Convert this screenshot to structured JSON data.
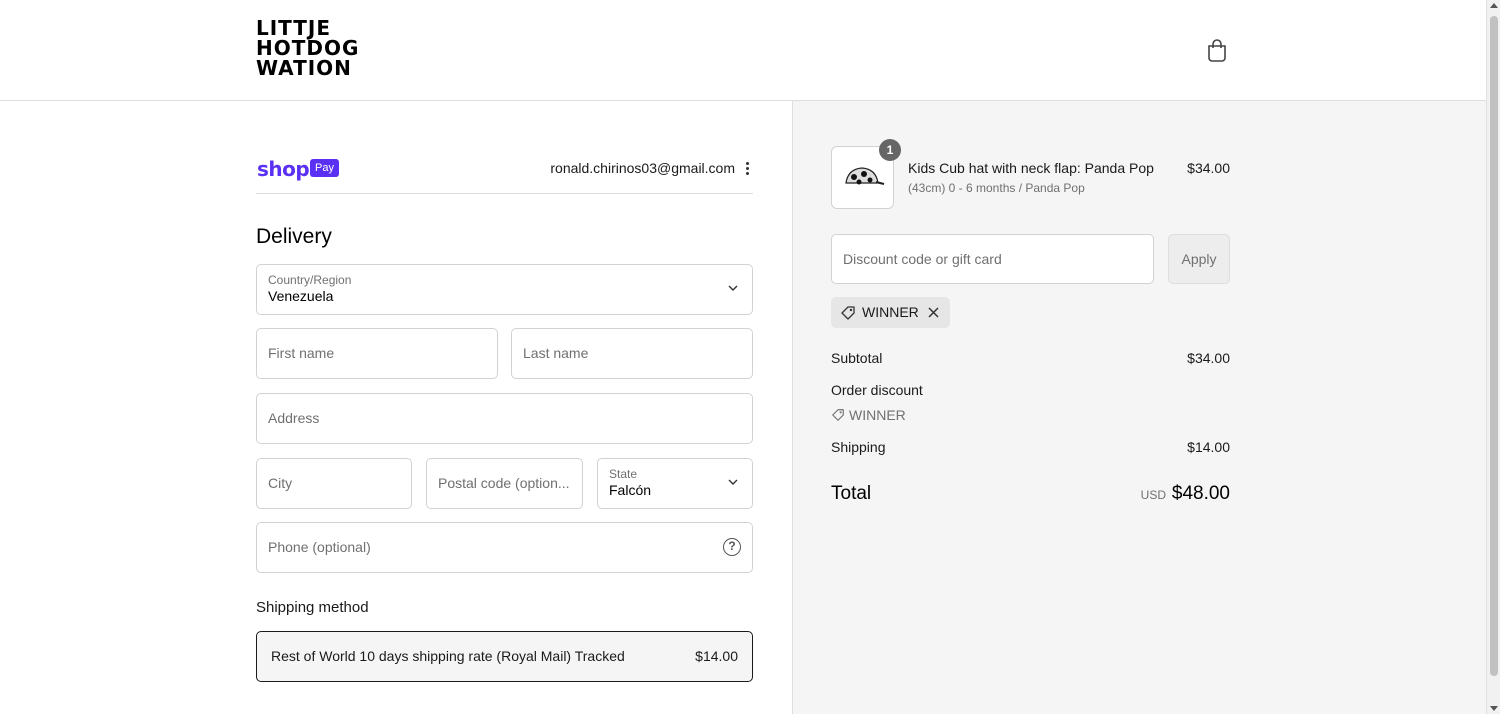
{
  "header": {
    "logo_lines": [
      "LITTJE",
      "HOTDOG",
      "WATION"
    ],
    "cart_icon": "shopping-bag-icon"
  },
  "account": {
    "shop_logo": "shop",
    "shop_pay_badge": "Pay",
    "email": "ronald.chirinos03@gmail.com",
    "menu_icon": "kebab-menu-icon",
    "brand_color": "#5a31f4"
  },
  "delivery": {
    "heading": "Delivery",
    "country": {
      "label": "Country/Region",
      "value": "Venezuela"
    },
    "first_name": {
      "placeholder": "First name"
    },
    "last_name": {
      "placeholder": "Last name"
    },
    "address": {
      "placeholder": "Address"
    },
    "city": {
      "placeholder": "City"
    },
    "postal": {
      "placeholder": "Postal code (option..."
    },
    "state": {
      "label": "State",
      "value": "Falcón"
    },
    "phone": {
      "placeholder": "Phone (optional)",
      "help_icon": "question-circle-icon"
    }
  },
  "shipping": {
    "heading": "Shipping method",
    "option_name": "Rest of World 10 days shipping rate (Royal Mail) Tracked",
    "option_price": "$14.00"
  },
  "summary": {
    "product": {
      "quantity": "1",
      "name": "Kids Cub hat with neck flap: Panda Pop",
      "variant": "(43cm) 0 - 6 months / Panda Pop",
      "price": "$34.00"
    },
    "discount_placeholder": "Discount code or gift card",
    "apply_label": "Apply",
    "applied_code": "WINNER",
    "subtotal_label": "Subtotal",
    "subtotal_value": "$34.00",
    "order_discount_label": "Order discount",
    "order_discount_code": "WINNER",
    "shipping_label": "Shipping",
    "shipping_value": "$14.00",
    "total_label": "Total",
    "total_currency": "USD",
    "total_value": "$48.00"
  }
}
